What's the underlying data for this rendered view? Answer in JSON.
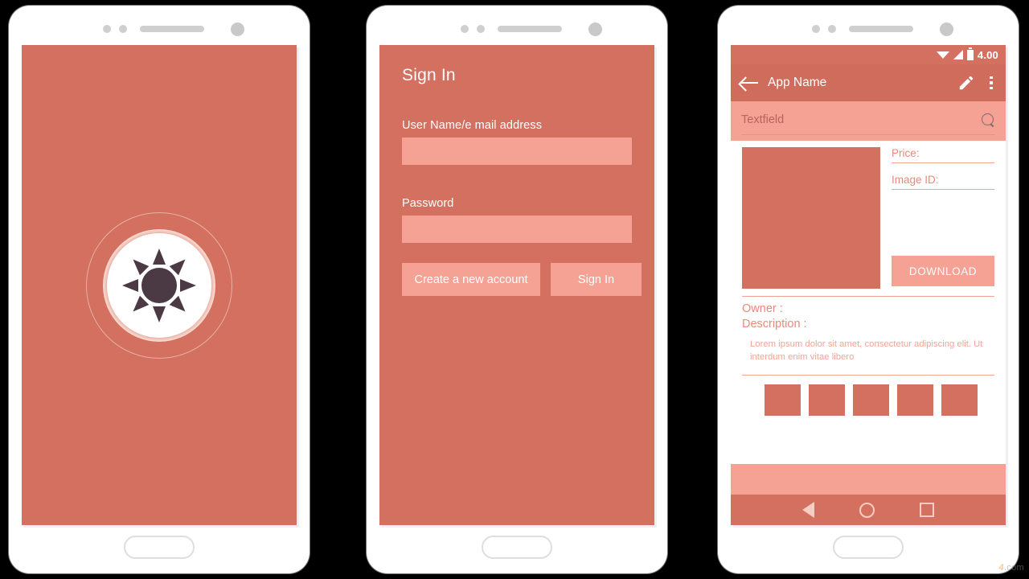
{
  "meta": {
    "background_color": "#000000",
    "accent_primary": "#d4705f",
    "accent_light": "#f5a193",
    "text_on_accent": "#ffffff"
  },
  "watermark": {
    "mark": "4",
    "text": ".com"
  },
  "screen1": {
    "name": "splash-screen",
    "background": "#d4705f",
    "logo": {
      "icon": "sun-icon",
      "ray_count": 8,
      "core_color": "#4b3a43",
      "disc_color": "#ffffff"
    }
  },
  "screen2": {
    "name": "sign-in-screen",
    "title": "Sign In",
    "fields": [
      {
        "label": "User Name/e mail address",
        "value": "",
        "placeholder": ""
      },
      {
        "label": "Password",
        "value": "",
        "placeholder": ""
      }
    ],
    "buttons": {
      "create_account": "Create a new account",
      "sign_in": "Sign In"
    }
  },
  "screen3": {
    "name": "detail-screen",
    "statusbar": {
      "time": "4.00",
      "icons": [
        "wifi-icon",
        "signal-icon",
        "battery-icon"
      ]
    },
    "appbar": {
      "back_icon": "back-arrow-icon",
      "title": "App Name",
      "edit_icon": "pencil-icon",
      "overflow_icon": "overflow-menu-icon"
    },
    "search": {
      "placeholder": "Textfield",
      "value": "",
      "icon": "search-icon"
    },
    "details": {
      "price_label": "Price:",
      "price_value": "",
      "image_id_label": "Image ID:",
      "image_id_value": "",
      "download_button": "DOWNLOAD"
    },
    "info": {
      "owner_label": "Owner :",
      "owner_value": "",
      "description_label": "Description :",
      "description_text": "Lorem ipsum dolor sit amet, consectetur adipiscing elit. Ut interdum enim vitae libero"
    },
    "thumbnails_count": 5,
    "navbar": {
      "back_icon": "nav-back-icon",
      "home_icon": "nav-home-icon",
      "recents_icon": "nav-recents-icon"
    }
  }
}
